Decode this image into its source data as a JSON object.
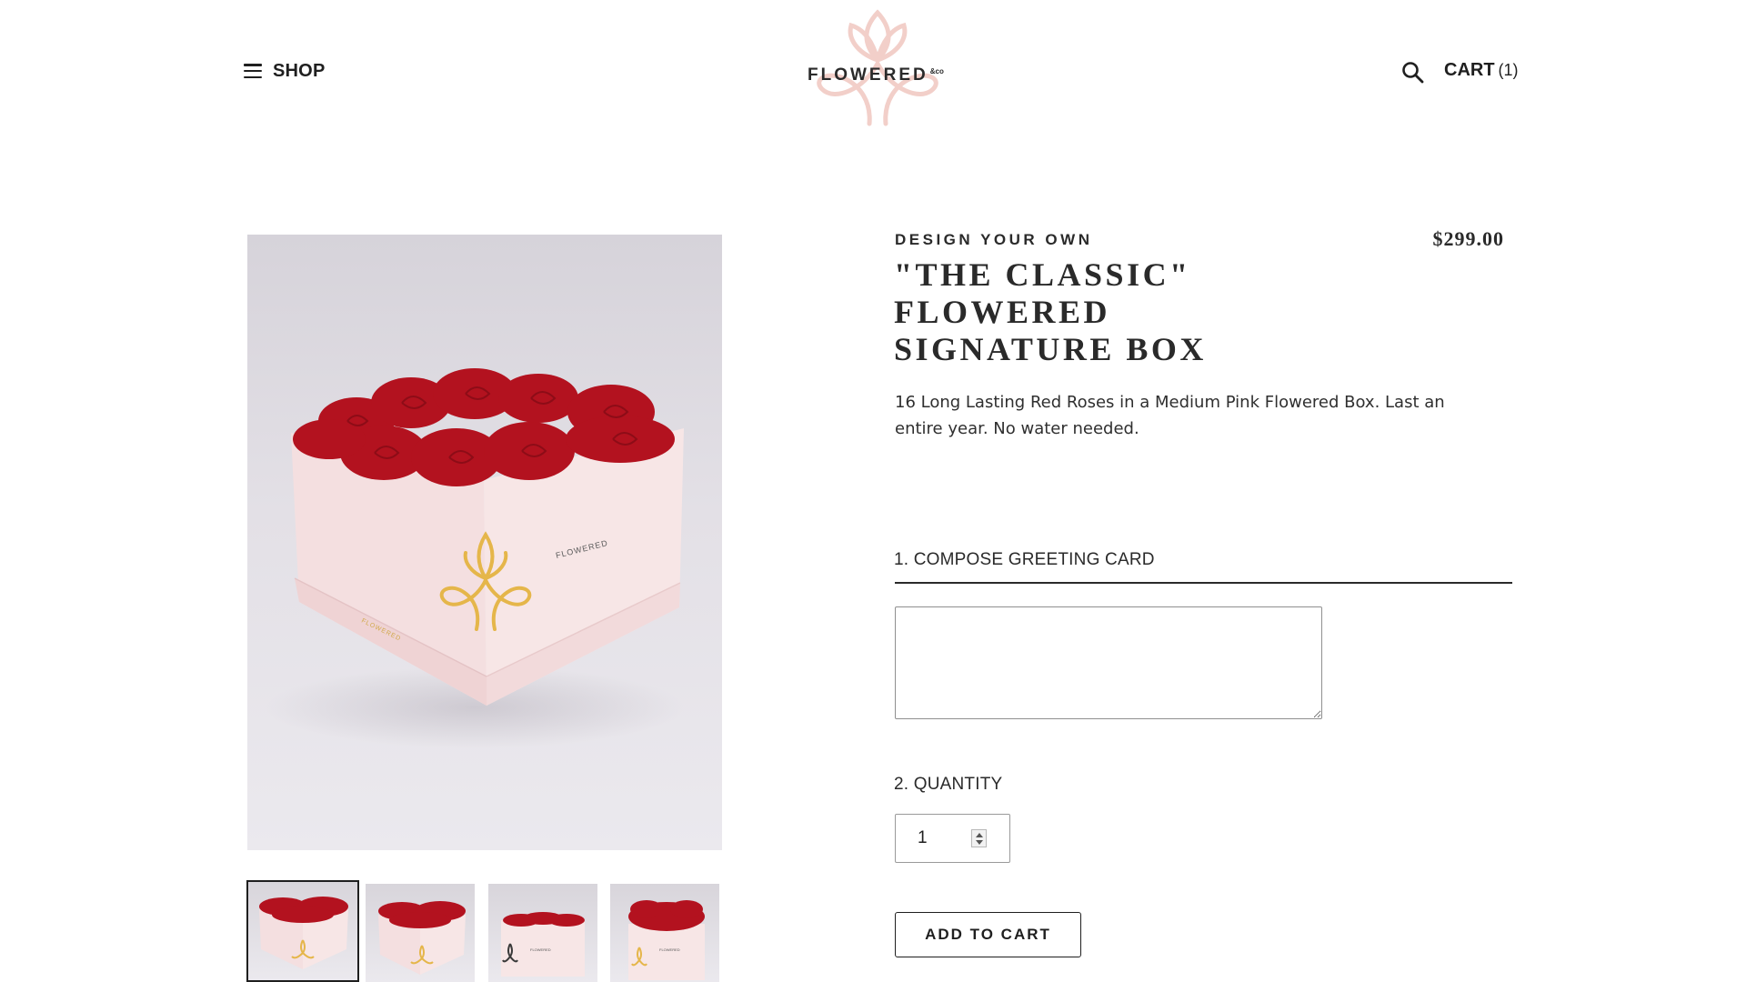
{
  "header": {
    "shop_label": "SHOP",
    "logo_text": "FLOWERED",
    "logo_suffix": "&co",
    "cart_label": "CART",
    "cart_count": "(1)"
  },
  "product": {
    "eyebrow": "DESIGN YOUR OWN",
    "title": "\"THE CLASSIC\"\nFLOWERED\nSIGNATURE BOX",
    "price": "$299.00",
    "description": "16 Long Lasting Red Roses in a Medium Pink Flowered Box. Last an entire year. No water needed."
  },
  "form": {
    "greeting_label": "1. COMPOSE GREETING CARD",
    "greeting_value": "",
    "quantity_label": "2. QUANTITY",
    "quantity_value": "1",
    "add_to_cart_label": "ADD TO CART"
  },
  "gallery": {
    "thumbnail_count": 4,
    "selected_index": 0
  },
  "colors": {
    "logo_pink": "#f2cfc9",
    "box_pink": "#f4dfe0",
    "rose_red": "#b3121f",
    "gold": "#e5b64a",
    "text_dark": "#1f1f1f"
  },
  "icons": {
    "menu": "hamburger-icon",
    "search": "search-icon",
    "stepper": "spinner-icon"
  }
}
